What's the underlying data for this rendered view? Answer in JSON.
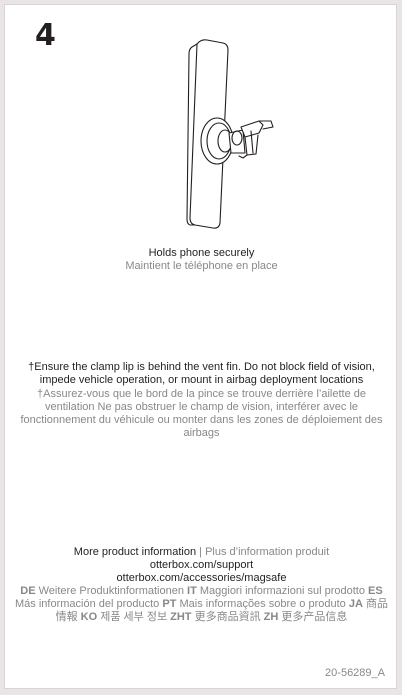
{
  "step": "4",
  "caption": {
    "en": "Holds phone securely",
    "fr": "Maintient le téléphone en place"
  },
  "warning": {
    "en": "†Ensure the clamp lip is behind the vent fin. Do not block field of vision, impede vehicle operation, or mount in airbag deployment locations",
    "fr": "†Assurez-vous que le bord de la pince se trouve derrière l’ailette de ventilation Ne pas obstruer le champ de vision, interférer avec le fonctionnement du véhicule ou monter dans les zones de déploiement des airbags"
  },
  "info": {
    "en": "More product information",
    "separator": " | ",
    "fr": "Plus d’information produit",
    "url_support": "otterbox.com/support",
    "url_magsafe": "otterbox.com/accessories/magsafe",
    "languages": [
      {
        "code": "DE",
        "text": "Weitere Produktinformationen"
      },
      {
        "code": "IT",
        "text": "Maggiori informazioni sul prodotto"
      },
      {
        "code": "ES",
        "text": "Más información del producto"
      },
      {
        "code": "PT",
        "text": "Mais informações sobre o produto"
      },
      {
        "code": "JA",
        "text": "商品情報"
      },
      {
        "code": "KO",
        "text": "제품 세부 정보"
      },
      {
        "code": "ZHT",
        "text": "更多商品資訊"
      },
      {
        "code": "ZH",
        "text": "更多产品信息"
      }
    ]
  },
  "part_number": "20-56289_A",
  "colors": {
    "border": "#e9e5e6",
    "text_dark": "#231f20",
    "text_grey": "#8a8789"
  }
}
